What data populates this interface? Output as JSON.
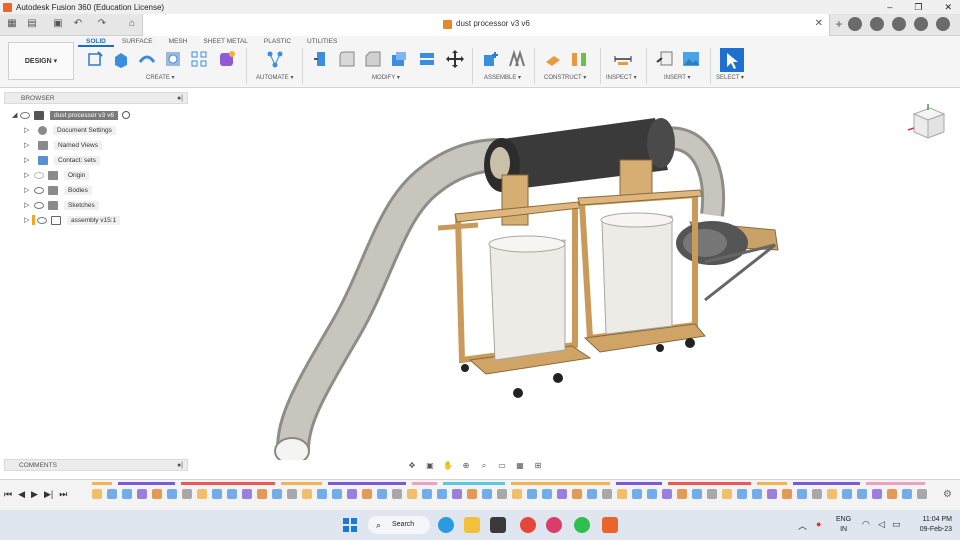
{
  "window": {
    "title": "Autodesk Fusion 360 (Education License)"
  },
  "document": {
    "title": "dust processor v3 v6"
  },
  "workspace": {
    "label": "DESIGN ▾"
  },
  "tabs": [
    {
      "label": "SOLID"
    },
    {
      "label": "SURFACE"
    },
    {
      "label": "MESH"
    },
    {
      "label": "SHEET METAL"
    },
    {
      "label": "PLASTIC"
    },
    {
      "label": "UTILITIES"
    }
  ],
  "groups": {
    "create": "CREATE ▾",
    "automate": "AUTOMATE ▾",
    "modify": "MODIFY ▾",
    "assemble": "ASSEMBLE ▾",
    "construct": "CONSTRUCT ▾",
    "inspect": "INSPECT ▾",
    "insert": "INSERT ▾",
    "select": "SELECT ▾"
  },
  "browser": {
    "header": "BROWSER",
    "root": "dust processor v3 v6",
    "items": [
      {
        "label": "Document Settings",
        "icon": "gear-icon"
      },
      {
        "label": "Named Views",
        "icon": "folder-icon"
      },
      {
        "label": "Contact: sets",
        "icon": "contact-icon"
      },
      {
        "label": "Origin",
        "icon": "folder-icon"
      },
      {
        "label": "Bodies",
        "icon": "folder-icon"
      },
      {
        "label": "Sketches",
        "icon": "folder-icon"
      },
      {
        "label": "assembly v15:1",
        "icon": "component-icon"
      }
    ]
  },
  "comments": {
    "header": "COMMENTS"
  },
  "taskbar": {
    "search": "Search",
    "lang_line1": "ENG",
    "lang_line2": "IN",
    "time": "11:04 PM",
    "date": "09-Feb-23"
  },
  "colors": {
    "accent": "#1a6ccf",
    "wood": "#d9b075",
    "pipe": "#b9b7b0",
    "cylinder": "#3a3a3a",
    "bucket": "#ecebe6"
  }
}
